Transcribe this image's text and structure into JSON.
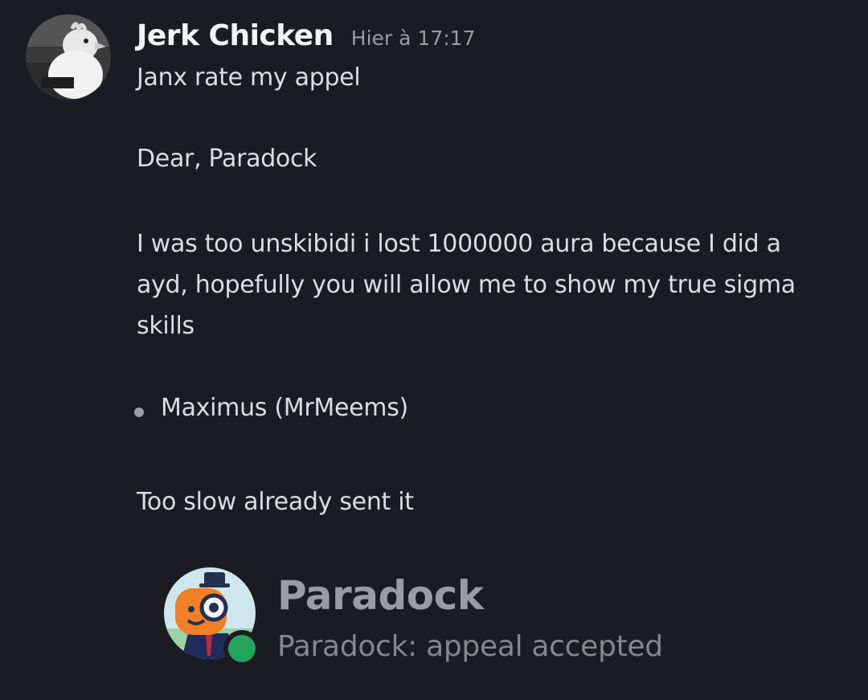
{
  "message": {
    "author": "Jerk Chicken",
    "timestamp": "Hier à 17:17",
    "avatar_icon": "chicken-avatar",
    "lines": {
      "intro": "Janx rate my appel",
      "greeting": "Dear, Paradock",
      "body": "I was too unskibidi i lost 1000000 aura because I did a ayd, hopefully you will allow me to show my true sigma skills",
      "bullet": "Maximus (MrMeems)",
      "followup": "Too slow already sent it"
    }
  },
  "embed": {
    "title": "Paradock",
    "subtitle": "Paradock: appeal accepted",
    "avatar_icon": "paradock-bot-avatar",
    "status": "online",
    "status_color": "#23a55a"
  },
  "colors": {
    "background": "#1b1c21",
    "text": "#dcdde1",
    "username": "#f2f3f5",
    "muted": "#9a9ba3"
  }
}
